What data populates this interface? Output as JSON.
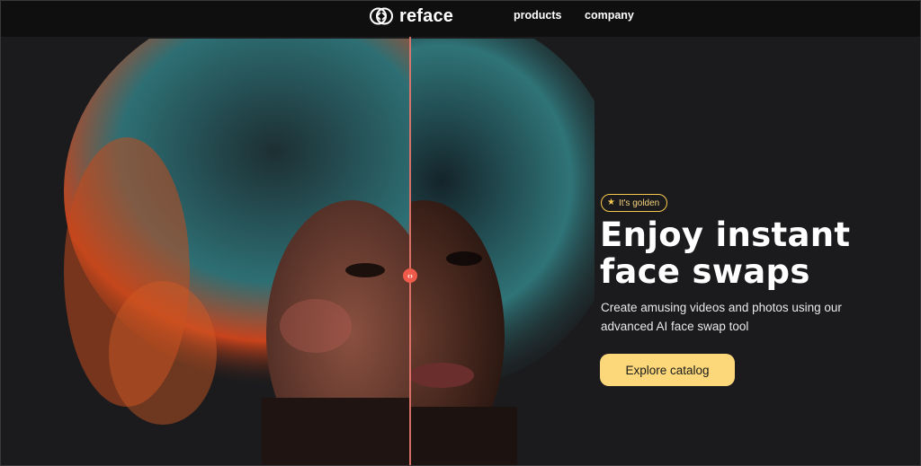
{
  "nav": {
    "logo_text": "reface",
    "links": [
      "products",
      "company"
    ]
  },
  "hero": {
    "badge_label": "It's golden",
    "headline_lines": [
      "Enjoy instant",
      "face swaps"
    ],
    "subtext": "Create amusing videos and photos using our advanced AI face swap tool",
    "cta_label": "Explore catalog",
    "slider_handle_glyph": "‹›"
  },
  "colors": {
    "background": "#1b1b1d",
    "nav_background": "#0f0f10",
    "accent_yellow": "#fcd87a",
    "badge_border": "#f6c94e",
    "divider": "#e8786e",
    "handle": "#ef5a4a"
  },
  "icons": {
    "logo": "reface-logo-icon",
    "badge": "star-icon",
    "slider": "slider-handle-icon"
  }
}
